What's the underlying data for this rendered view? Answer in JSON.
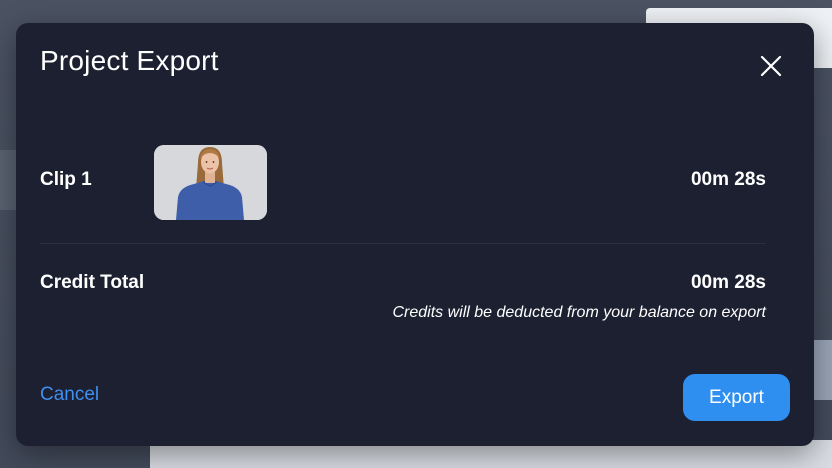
{
  "modal": {
    "title": "Project Export",
    "close_icon": "close-icon",
    "clip": {
      "label": "Clip 1",
      "duration": "00m 28s"
    },
    "credit": {
      "label": "Credit Total",
      "value": "00m 28s",
      "note": "Credits will be deducted from your balance on export"
    },
    "actions": {
      "cancel_label": "Cancel",
      "export_label": "Export"
    }
  },
  "colors": {
    "modal_bg": "#1d2031",
    "accent": "#2f8ff0",
    "link": "#3f8ef0",
    "text": "#ffffff"
  }
}
